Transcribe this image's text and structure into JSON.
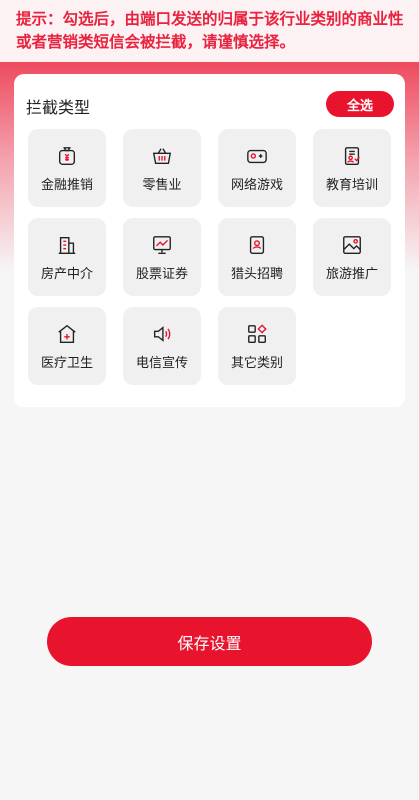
{
  "notice": {
    "text": "提示：勾选后，由端口发送的归属于该行业类别的商业性或者营销类短信会被拦截，请谨慎选择。"
  },
  "card": {
    "title": "拦截类型",
    "select_all": "全选"
  },
  "categories": [
    {
      "label": "金融推销",
      "icon": "money-bag-icon"
    },
    {
      "label": "零售业",
      "icon": "basket-icon"
    },
    {
      "label": "网络游戏",
      "icon": "gamepad-icon"
    },
    {
      "label": "教育培训",
      "icon": "education-icon"
    },
    {
      "label": "房产中介",
      "icon": "building-icon"
    },
    {
      "label": "股票证券",
      "icon": "stock-chart-icon"
    },
    {
      "label": "猎头招聘",
      "icon": "id-badge-icon"
    },
    {
      "label": "旅游推广",
      "icon": "landscape-icon"
    },
    {
      "label": "医疗卫生",
      "icon": "hospital-icon"
    },
    {
      "label": "电信宣传",
      "icon": "speaker-icon"
    },
    {
      "label": "其它类别",
      "icon": "grid-icon"
    }
  ],
  "save_label": "保存设置",
  "colors": {
    "accent": "#e8142e",
    "notice_text": "#e8233f"
  }
}
